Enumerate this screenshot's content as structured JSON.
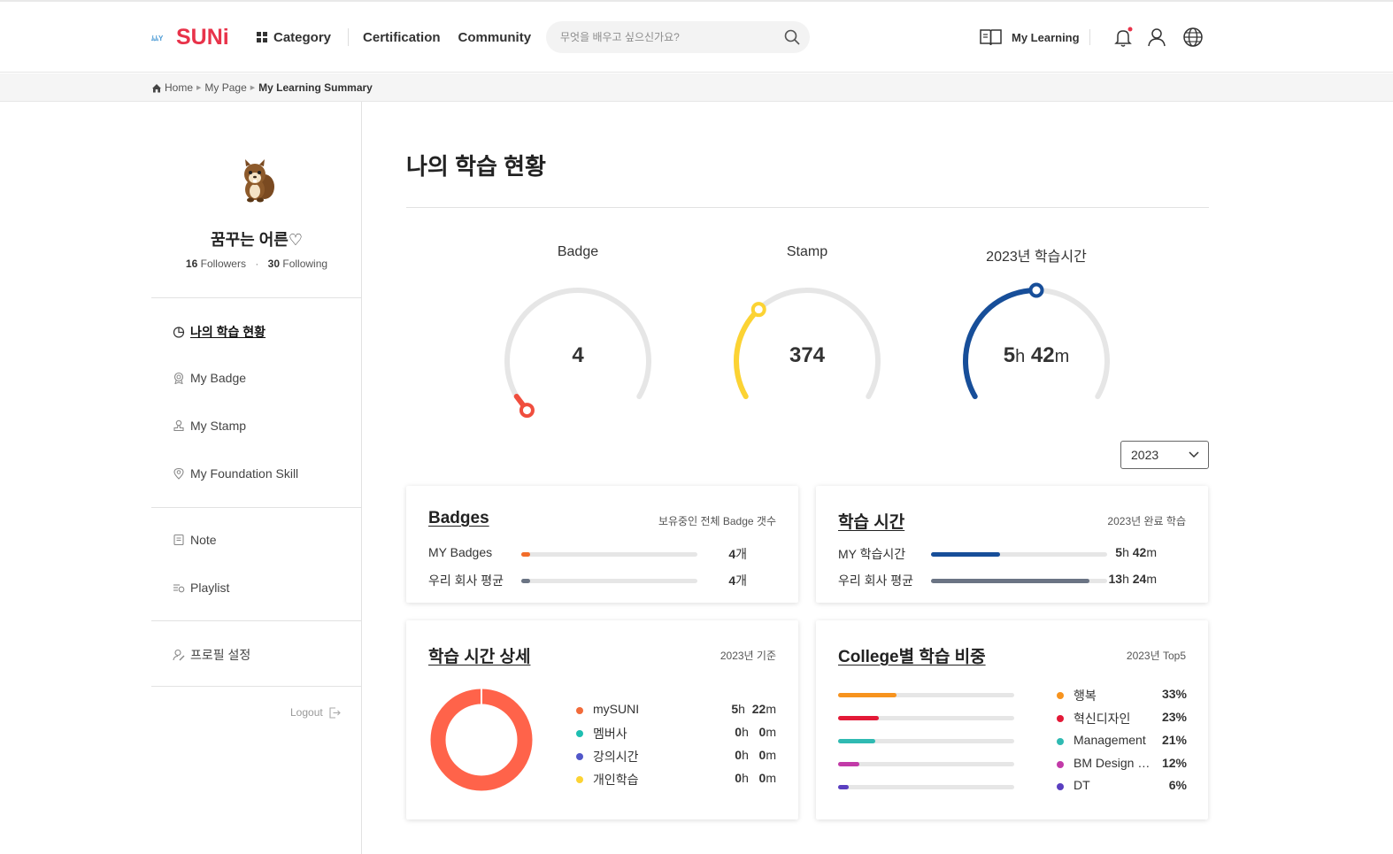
{
  "header": {
    "logo_text": "mySUNi",
    "nav": {
      "category": "Category",
      "certification": "Certification",
      "community": "Community"
    },
    "search_placeholder": "무엇을 배우고 싶으신가요?",
    "my_learning": "My Learning",
    "icons": [
      "bell-icon",
      "user-icon",
      "globe-icon"
    ],
    "notification_dot_color": "#e8334a"
  },
  "breadcrumb": {
    "home": "Home",
    "mypage": "My Page",
    "current": "My Learning Summary"
  },
  "profile": {
    "nickname": "꿈꾸는 어른♡",
    "followers_count": "16",
    "followers_label": "Followers",
    "following_count": "30",
    "following_label": "Following"
  },
  "sidebar": {
    "menu": [
      {
        "label": "나의 학습 현황",
        "icon": "chart-icon",
        "active": true
      },
      {
        "label": "My Badge",
        "icon": "badge-icon"
      },
      {
        "label": "My Stamp",
        "icon": "stamp-icon"
      },
      {
        "label": "My Foundation Skill",
        "icon": "skill-icon"
      },
      {
        "label": "Note",
        "icon": "note-icon"
      },
      {
        "label": "Playlist",
        "icon": "playlist-icon"
      },
      {
        "label": "프로필 설정",
        "icon": "profile-settings-icon"
      }
    ],
    "logout": "Logout"
  },
  "main": {
    "title": "나의 학습 현황",
    "gauges": [
      {
        "label": "Badge",
        "value": "4",
        "progress": 0.0,
        "color": "#f04e3e"
      },
      {
        "label": "Stamp",
        "value": "374",
        "progress": 0.32,
        "color": "#fcd333"
      },
      {
        "label": "2023년 학습시간",
        "hours": "5",
        "h_unit": "h",
        "minutes": "42",
        "m_unit": "m",
        "progress": 0.5,
        "color": "#174e99"
      }
    ],
    "year_select": "2023",
    "badges_card": {
      "title": "Badges",
      "subtitle": "보유중인 전체 Badge 갯수",
      "rows": [
        {
          "label": "MY Badges",
          "value": "4",
          "unit": "개",
          "ratio": 0.05,
          "color": "#f26d2a"
        },
        {
          "label": "우리 회사 평균",
          "value": "4",
          "unit": "개",
          "ratio": 0.05,
          "color": "#6b7484"
        }
      ]
    },
    "time_card": {
      "title": "학습 시간",
      "subtitle": "2023년 완료 학습",
      "rows": [
        {
          "label": "MY 학습시간",
          "h": "5",
          "m": "42",
          "h_unit": "h",
          "m_unit": "m",
          "ratio": 0.39,
          "color": "#174e99"
        },
        {
          "label": "우리 회사 평균",
          "h": "13",
          "m": "24",
          "h_unit": "h",
          "m_unit": "m",
          "ratio": 0.9,
          "color": "#6b7484"
        }
      ]
    },
    "detail_card": {
      "title": "학습 시간 상세",
      "subtitle": "2023년 기준",
      "items": [
        {
          "label": "mySUNI",
          "h": "5",
          "m": "22",
          "color": "#f26b3a"
        },
        {
          "label": "멤버사",
          "h": "0",
          "m": "0",
          "color": "#1ebeb1"
        },
        {
          "label": "강의시간",
          "h": "0",
          "m": "0",
          "color": "#5157c9"
        },
        {
          "label": "개인학습",
          "h": "0",
          "m": "0",
          "color": "#fcd333"
        }
      ],
      "h_unit": "h",
      "m_unit": "m",
      "donut_color": "#ff634a"
    },
    "college_card": {
      "title": "College별 학습 비중",
      "subtitle": "2023년 Top5",
      "items": [
        {
          "label": "행복",
          "value": "33%",
          "ratio": 0.33,
          "color": "#f7931e"
        },
        {
          "label": "혁신디자인",
          "value": "23%",
          "ratio": 0.23,
          "color": "#e31937"
        },
        {
          "label": "Management",
          "value": "21%",
          "ratio": 0.21,
          "color": "#2fbab2"
        },
        {
          "label": "BM Design …",
          "value": "12%",
          "ratio": 0.12,
          "color": "#c23aa8"
        },
        {
          "label": "DT",
          "value": "6%",
          "ratio": 0.06,
          "color": "#5a3fc0"
        }
      ]
    }
  }
}
